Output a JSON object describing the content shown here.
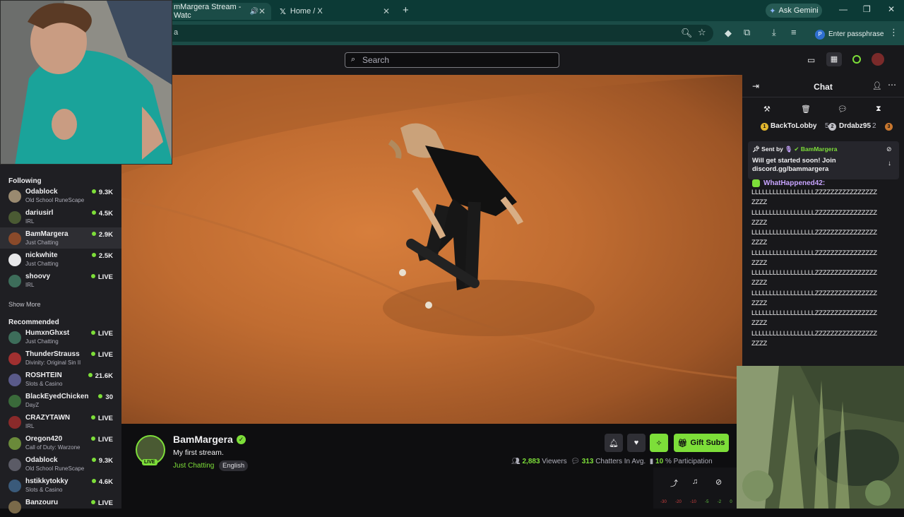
{
  "browser": {
    "tabs": [
      {
        "title": "mMargera Stream - Watc"
      },
      {
        "title": "Home / X"
      }
    ],
    "new_tab": "+",
    "ask_gemini": "Ask Gemini",
    "url_fragment": "a",
    "passphrase": "Enter passphrase",
    "profile_initial": "P"
  },
  "twitch_nav": {
    "search_placeholder": "Search"
  },
  "sidebar": {
    "following_label": "Following",
    "following": [
      {
        "name": "Odablock",
        "game": "Old School RuneScape",
        "viewers": "9.3K"
      },
      {
        "name": "dariusirl",
        "game": "IRL",
        "viewers": "4.5K"
      },
      {
        "name": "BamMargera",
        "game": "Just Chatting",
        "viewers": "2.9K"
      },
      {
        "name": "nickwhite",
        "game": "Just Chatting",
        "viewers": "2.5K"
      },
      {
        "name": "shoovy",
        "game": "IRL",
        "viewers": "LIVE"
      }
    ],
    "show_more": "Show More",
    "recommended_label": "Recommended",
    "recommended": [
      {
        "name": "HumxnGhxst",
        "game": "Just Chatting",
        "viewers": "LIVE"
      },
      {
        "name": "ThunderStrauss",
        "game": "Divinity: Original Sin II",
        "viewers": "LIVE"
      },
      {
        "name": "ROSHTEIN",
        "game": "Slots & Casino",
        "viewers": "21.6K"
      },
      {
        "name": "BlackEyedChicken",
        "game": "DayZ",
        "viewers": "30"
      },
      {
        "name": "CRAZYTAWN",
        "game": "IRL",
        "viewers": "LIVE"
      },
      {
        "name": "Oregon420",
        "game": "Call of Duty: Warzone",
        "viewers": "LIVE"
      },
      {
        "name": "Odablock",
        "game": "Old School RuneScape",
        "viewers": "9.3K"
      },
      {
        "name": "hstikkytokky",
        "game": "Slots & Casino",
        "viewers": "4.6K"
      },
      {
        "name": "Banzouru",
        "game": "",
        "viewers": "LIVE"
      }
    ]
  },
  "stream_info": {
    "live_badge": "LIVE",
    "channel_name": "BamMargera",
    "title": "My first stream.",
    "category": "Just Chatting",
    "language": "English",
    "gift_label": "Gift Subs",
    "viewers_count": "2,883",
    "viewers_label": "Viewers",
    "chatters_count": "313",
    "chatters_label": "Chatters In Avg.",
    "participation_count": "10",
    "participation_label": "% Participation"
  },
  "chat": {
    "title": "Chat",
    "leaderboard": [
      {
        "rank": "1",
        "name": "BackToLobby",
        "value": "5"
      },
      {
        "rank": "2",
        "name": "Drdabz95",
        "value": "2"
      },
      {
        "rank": "3",
        "name": "",
        "value": ""
      }
    ],
    "pinned_sent_by": "Sent by",
    "pinned_author": "BamMargera",
    "pinned_message": "Will get started soon! Join discord.gg/bammargera",
    "message_author": "WhatHappened42:",
    "spam_line_a": "LLLLLLLLLLLLLLLLLLZZZZZZZZZZZZZZZZ",
    "spam_line_b": "ZZZZ"
  },
  "mini_overlay": {
    "levels": [
      "-30",
      "-20",
      "-10",
      "-5",
      "-2",
      "0"
    ]
  },
  "colors": {
    "accent": "#7dde39",
    "chrome_bg": "#0c3a36",
    "twitch_bg": "#0e0e10"
  }
}
